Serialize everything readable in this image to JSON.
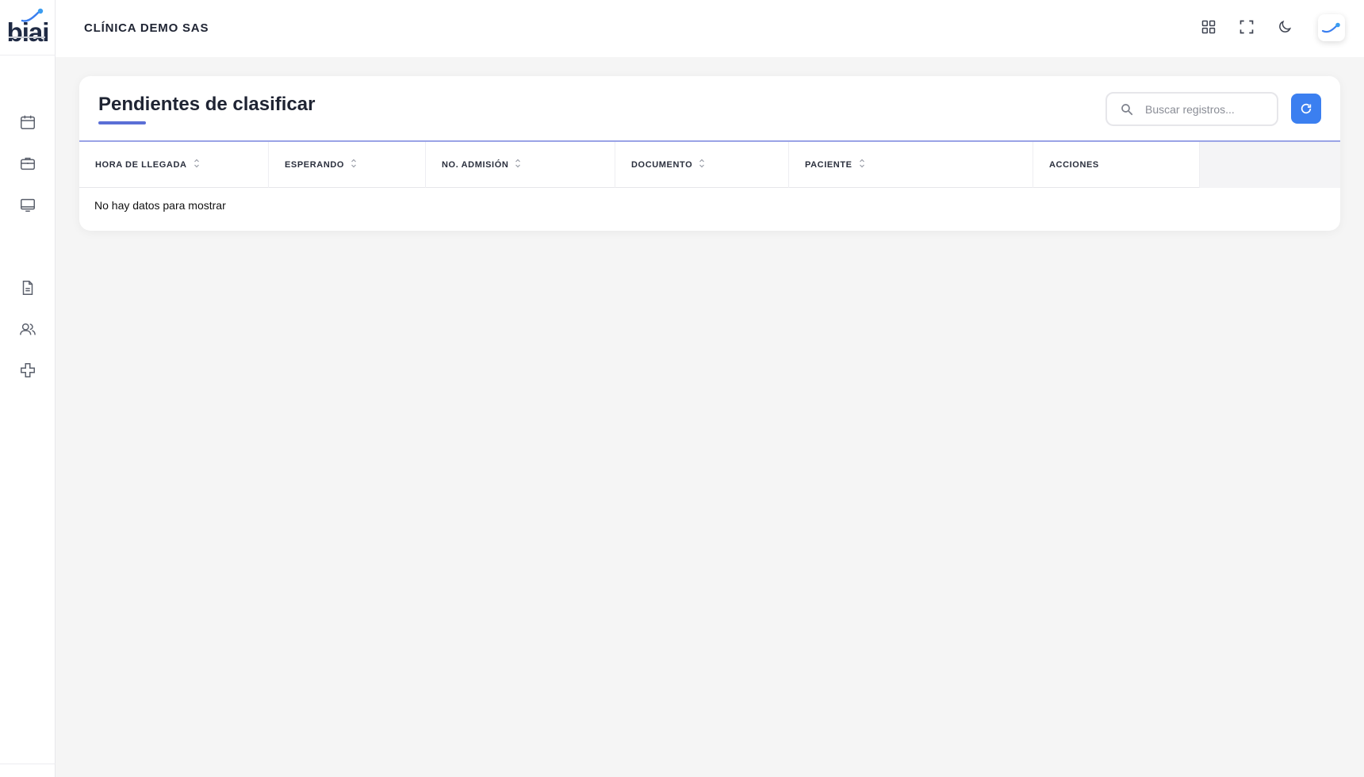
{
  "app": {
    "logo_text": "biai"
  },
  "sidebar": {
    "items": [
      {
        "icon": "calendar-icon"
      },
      {
        "icon": "briefcase-icon"
      },
      {
        "icon": "monitor-icon"
      },
      {
        "icon": "document-icon"
      },
      {
        "icon": "users-icon"
      },
      {
        "icon": "medical-cross-icon"
      }
    ]
  },
  "header": {
    "company": "CLÍNICA DEMO SAS",
    "icons": [
      "grid-icon",
      "fullscreen-icon",
      "moon-icon"
    ],
    "avatar_icon": "user-avatar-logo"
  },
  "main": {
    "title": "Pendientes de clasificar",
    "search": {
      "placeholder": "Buscar registros...",
      "value": ""
    },
    "refresh_icon": "refresh-icon",
    "table": {
      "columns": [
        "HORA DE LLEGADA",
        "ESPERANDO",
        "NO. ADMISIÓN",
        "DOCUMENTO",
        "PACIENTE",
        "ACCIONES"
      ],
      "rows": [],
      "empty_message": "No hay datos para mostrar"
    }
  },
  "colors": {
    "accent": "#5b6fd6",
    "primary_button": "#3b7ff0",
    "background": "#f5f5f5",
    "table_top_line": "#9aa3e6"
  }
}
